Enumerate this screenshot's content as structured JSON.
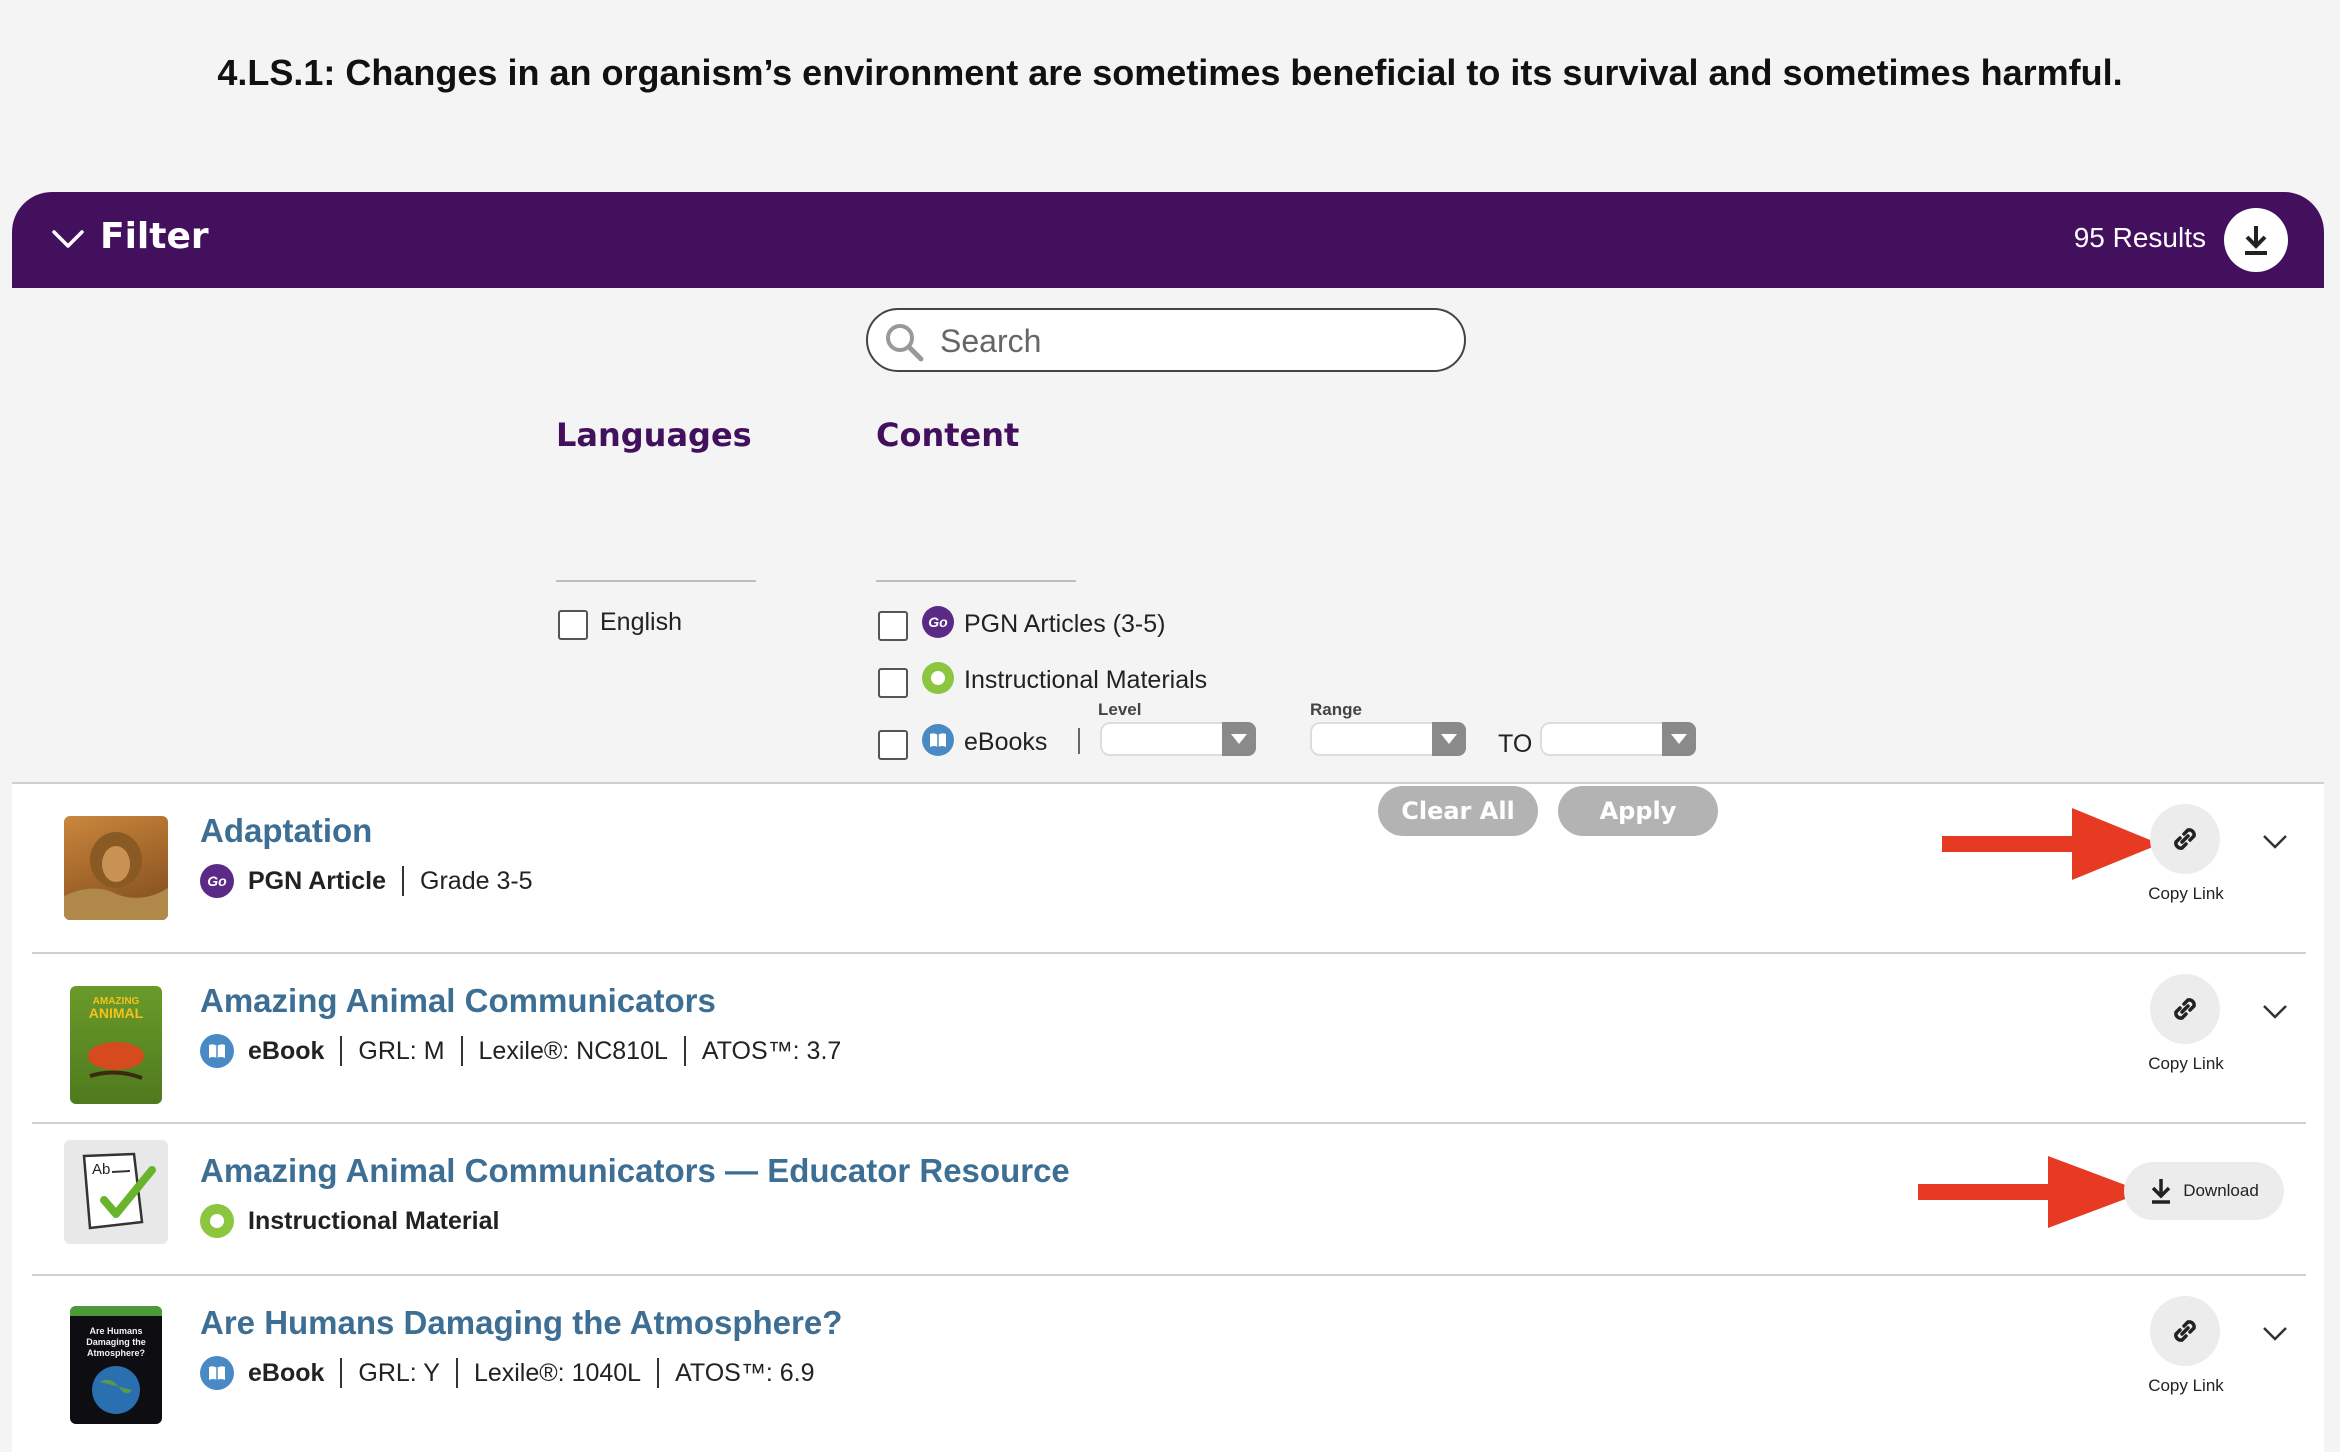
{
  "page": {
    "standard_text": "4.LS.1: Changes in an organism’s environment are sometimes beneficial to its survival and sometimes harmful."
  },
  "filter": {
    "title": "Filter",
    "results": "95 Results",
    "search_placeholder": "Search",
    "languages": {
      "heading": "Languages",
      "options": [
        {
          "label": "English",
          "checked": false
        }
      ]
    },
    "content": {
      "heading": "Content",
      "options": [
        {
          "label": "PGN Articles (3-5)",
          "icon": "go-icon",
          "checked": false
        },
        {
          "label": "Instructional Materials",
          "icon": "apple-icon",
          "checked": false
        },
        {
          "label": "eBooks",
          "icon": "book-icon",
          "checked": false
        }
      ],
      "level_label": "Level",
      "range_label": "Range",
      "to_label": "TO"
    },
    "clear_label": "Clear All",
    "apply_label": "Apply"
  },
  "results": [
    {
      "title": "Adaptation",
      "type": "PGN Article",
      "type_icon": "go-icon",
      "meta": [
        "Grade 3-5"
      ],
      "action": "Copy Link",
      "thumb": "lion-photo"
    },
    {
      "title": "Amazing Animal Communicators",
      "type": "eBook",
      "type_icon": "book-icon",
      "meta": [
        "GRL: M",
        "Lexile®: NC810L",
        "ATOS™: 3.7"
      ],
      "action": "Copy Link",
      "thumb": "chameleon-cover"
    },
    {
      "title": "Amazing Animal Communicators — Educator Resource",
      "type": "Instructional Material",
      "type_icon": "apple-icon",
      "meta": [],
      "action": "Download",
      "thumb": "worksheet-icon"
    },
    {
      "title": "Are Humans Damaging the Atmosphere?",
      "type": "eBook",
      "type_icon": "book-icon",
      "meta": [
        "GRL: Y",
        "Lexile®: 1040L",
        "ATOS™: 6.9"
      ],
      "action": "Copy Link",
      "thumb": "earth-cover"
    }
  ],
  "colors": {
    "header_purple": "#43105e",
    "title_blue": "#3d6e93",
    "annotation_red": "#e63a22",
    "go_purple": "#5b2a86",
    "apple_green": "#8cc63f",
    "book_blue": "#4a8ac4"
  }
}
